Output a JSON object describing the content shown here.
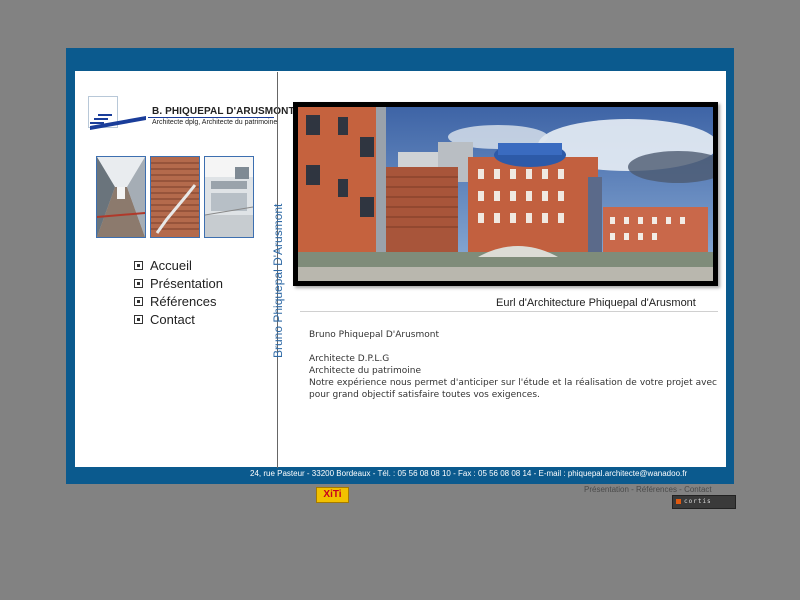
{
  "logo": {
    "name": "B. PHIQUEPAL D'ARUSMONT",
    "subtitle": "Architecte dplg, Architecte du patrimoine"
  },
  "sidebar": {
    "vertical_text": "Bruno Phiquepal D'Arusmont"
  },
  "nav": {
    "items": [
      {
        "label": "Accueil",
        "icon": "square-bullet-icon"
      },
      {
        "label": "Présentation",
        "icon": "square-bullet-icon"
      },
      {
        "label": "Références",
        "icon": "square-bullet-icon"
      },
      {
        "label": "Contact",
        "icon": "square-bullet-icon"
      }
    ]
  },
  "main": {
    "tagline": "Eurl d'Architecture Phiquepal d'Arusmont",
    "intro": {
      "name": "Bruno Phiquepal D'Arusmont",
      "title1": "Architecte D.P.L.G",
      "title2": "Architecte du patrimoine",
      "body": "Notre expérience nous permet d'anticiper sur l'étude et la réalisation de votre projet avec pour grand objectif satisfaire toutes vos exigences."
    }
  },
  "footer": {
    "address": "24, rue Pasteur - 33200 Bordeaux - Tél. : 05 56 08 08 10 - Fax : 05 56 08 08 14 - E-mail : phiquepal.architecte@wanadoo.fr",
    "links": [
      "Présentation",
      "Références",
      "Contact"
    ],
    "separator": " - ",
    "xiti": "XiTi",
    "cortis": "cortis"
  },
  "colors": {
    "frame": "#0b5a8e",
    "background": "#828282",
    "accent_text": "#2f6aa6"
  }
}
